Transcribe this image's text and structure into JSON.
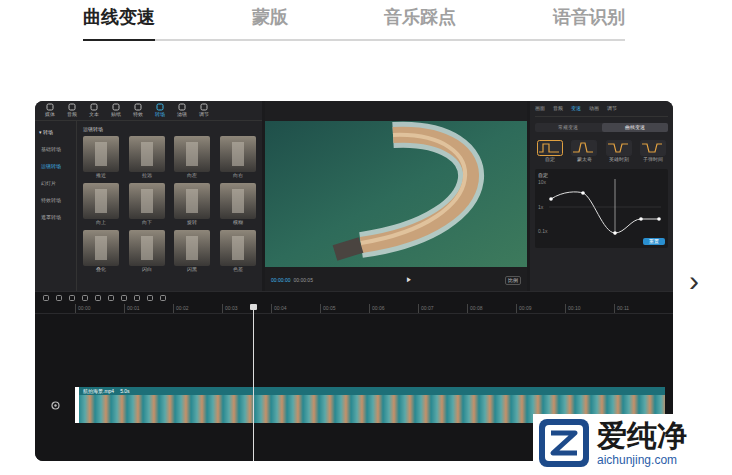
{
  "tabs": [
    {
      "label": "曲线变速",
      "selected": true
    },
    {
      "label": "蒙版",
      "selected": false
    },
    {
      "label": "音乐踩点",
      "selected": false
    },
    {
      "label": "语音识别",
      "selected": false
    }
  ],
  "editor": {
    "toolbar": [
      {
        "label": "媒体",
        "selected": false
      },
      {
        "label": "音频",
        "selected": false
      },
      {
        "label": "文本",
        "selected": false
      },
      {
        "label": "贴纸",
        "selected": false
      },
      {
        "label": "特效",
        "selected": false
      },
      {
        "label": "转场",
        "selected": true
      },
      {
        "label": "滤镜",
        "selected": false
      },
      {
        "label": "调节",
        "selected": false
      }
    ],
    "sidebar": {
      "header": "▾ 转场",
      "items": [
        {
          "label": "基础转场",
          "selected": false
        },
        {
          "label": "运镜转场",
          "selected": true
        },
        {
          "label": "幻灯片",
          "selected": false
        },
        {
          "label": "特效转场",
          "selected": false
        },
        {
          "label": "遮罩转场",
          "selected": false
        }
      ]
    },
    "grid": {
      "title": "运镜转场",
      "items": [
        "推近",
        "拉远",
        "向左",
        "向右",
        "向上",
        "向下",
        "旋转",
        "模糊",
        "叠化",
        "闪白",
        "闪黑",
        "色差"
      ]
    },
    "player": {
      "current": "00:00:00",
      "total": "00:00:05",
      "play": "▶",
      "ratio": "比例"
    },
    "inspector": {
      "tabs": [
        {
          "label": "画面",
          "selected": false
        },
        {
          "label": "音频",
          "selected": false
        },
        {
          "label": "变速",
          "selected": true
        },
        {
          "label": "动画",
          "selected": false
        },
        {
          "label": "调节",
          "selected": false
        }
      ],
      "modes": [
        {
          "label": "常规变速",
          "selected": false
        },
        {
          "label": "曲线变速",
          "selected": true
        }
      ],
      "presets": [
        {
          "label": "自定",
          "selected": true
        },
        {
          "label": "蒙太奇",
          "selected": false
        },
        {
          "label": "英雄时刻",
          "selected": false
        },
        {
          "label": "子弹时间",
          "selected": false
        }
      ],
      "graph_title": "自定",
      "axis": [
        "10x",
        "1x",
        "0.1x"
      ],
      "reset": "重置"
    },
    "timeline": {
      "ruler": [
        "00:00",
        "00:01",
        "00:02",
        "00:03",
        "00:04",
        "00:05",
        "00:06",
        "00:07",
        "00:08",
        "00:09",
        "00:10",
        "00:11"
      ],
      "clip": {
        "label": "航拍海景.mp4",
        "duration": "5.0s"
      }
    }
  },
  "next": "›",
  "watermark": {
    "name": "爱纯净",
    "url": "aichunjing.com"
  }
}
